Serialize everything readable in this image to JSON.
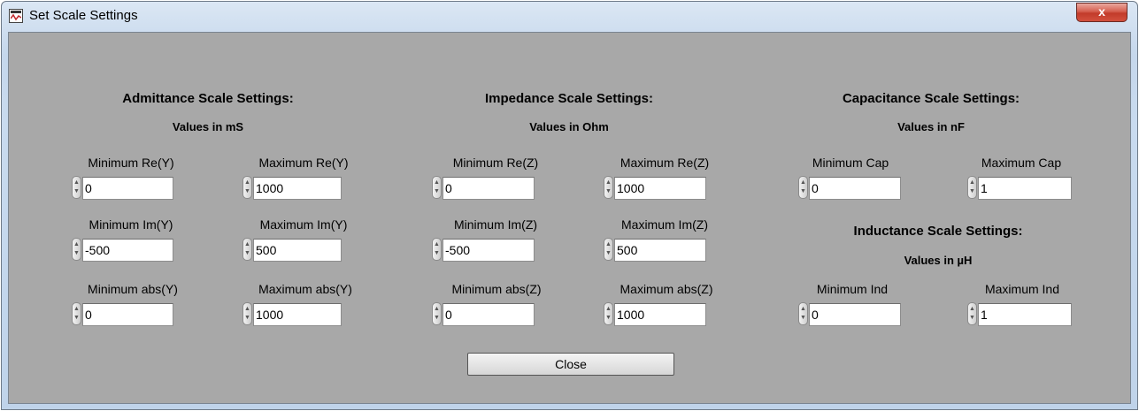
{
  "window": {
    "title": "Set Scale Settings",
    "close_glyph": "x"
  },
  "sections": {
    "admittance": {
      "title": "Admittance Scale Settings:",
      "unit": "Values in mS"
    },
    "impedance": {
      "title": "Impedance Scale Settings:",
      "unit": "Values in Ohm"
    },
    "capacitance": {
      "title": "Capacitance Scale Settings:",
      "unit": "Values in nF"
    },
    "inductance": {
      "title": "Inductance Scale Settings:",
      "unit": "Values in µH"
    }
  },
  "fields": {
    "min_re_y": {
      "label": "Minimum Re(Y)",
      "value": "0"
    },
    "max_re_y": {
      "label": "Maximum Re(Y)",
      "value": "1000"
    },
    "min_im_y": {
      "label": "Minimum Im(Y)",
      "value": "-500"
    },
    "max_im_y": {
      "label": "Maximum Im(Y)",
      "value": "500"
    },
    "min_abs_y": {
      "label": "Minimum abs(Y)",
      "value": "0"
    },
    "max_abs_y": {
      "label": "Maximum abs(Y)",
      "value": "1000"
    },
    "min_re_z": {
      "label": "Minimum Re(Z)",
      "value": "0"
    },
    "max_re_z": {
      "label": "Maximum Re(Z)",
      "value": "1000"
    },
    "min_im_z": {
      "label": "Minimum Im(Z)",
      "value": "-500"
    },
    "max_im_z": {
      "label": "Maximum Im(Z)",
      "value": "500"
    },
    "min_abs_z": {
      "label": "Minimum abs(Z)",
      "value": "0"
    },
    "max_abs_z": {
      "label": "Maximum abs(Z)",
      "value": "1000"
    },
    "min_cap": {
      "label": "Minimum Cap",
      "value": "0"
    },
    "max_cap": {
      "label": "Maximum Cap",
      "value": "1"
    },
    "min_ind": {
      "label": "Minimum Ind",
      "value": "0"
    },
    "max_ind": {
      "label": "Maximum Ind",
      "value": "1"
    }
  },
  "buttons": {
    "close_label": "Close"
  }
}
